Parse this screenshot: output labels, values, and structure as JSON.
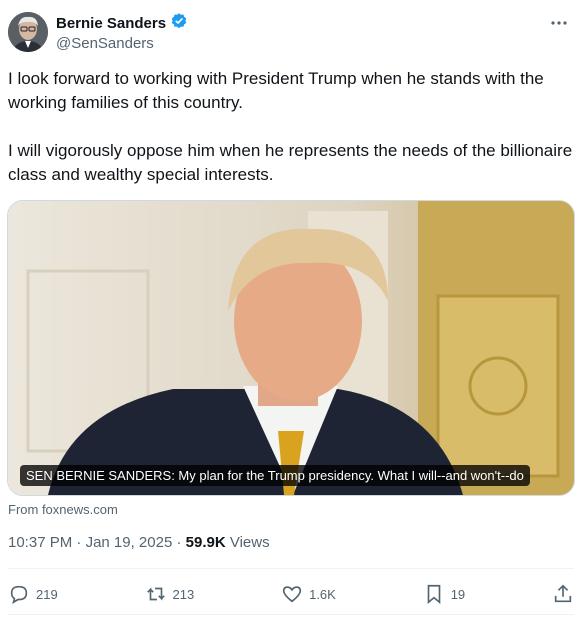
{
  "author": {
    "display_name": "Bernie Sanders",
    "handle": "@SenSanders",
    "verified_icon": "verified-badge-icon"
  },
  "tweet": {
    "paragraphs": [
      "I look forward to working with President Trump when he stands with the working families of this country.",
      "I will vigorously oppose him when he represents the needs of the billionaire class and wealthy special interests."
    ]
  },
  "media": {
    "caption": "SEN BERNIE SANDERS: My plan for the Trump presidency. What I will--and won't--do",
    "source": "From foxnews.com"
  },
  "meta": {
    "time": "10:37 PM",
    "separator": " · ",
    "date": "Jan 19, 2025",
    "views_count": "59.9K",
    "views_label": "Views"
  },
  "actions": {
    "replies": "219",
    "reposts": "213",
    "likes": "1.6K",
    "bookmarks": "19"
  },
  "colors": {
    "text": "#0f1419",
    "secondary": "#536471",
    "verified": "#1d9bf0",
    "border": "#cfd9de"
  }
}
